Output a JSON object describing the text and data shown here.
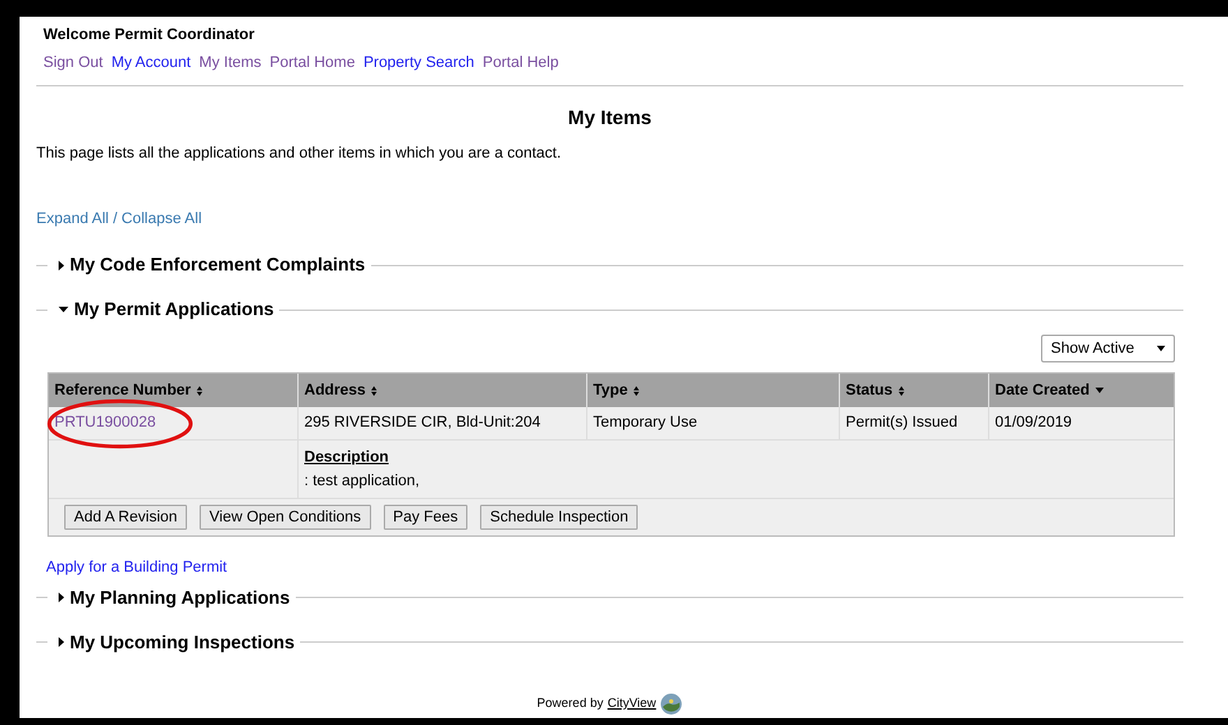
{
  "header": {
    "welcome": "Welcome Permit Coordinator",
    "nav": [
      {
        "label": "Sign Out",
        "visited": true
      },
      {
        "label": "My Account",
        "visited": false
      },
      {
        "label": "My Items",
        "visited": true
      },
      {
        "label": "Portal Home",
        "visited": true
      },
      {
        "label": "Property Search",
        "visited": false
      },
      {
        "label": "Portal Help",
        "visited": true
      }
    ]
  },
  "page_title": "My Items",
  "intro": "This page lists all the applications and other items in which you are a contact.",
  "expand_collapse": {
    "expand": "Expand All",
    "separator": "/",
    "collapse": "Collapse All"
  },
  "sections": [
    {
      "title": "My Code Enforcement Complaints",
      "expanded": false
    },
    {
      "title": "My Permit Applications",
      "expanded": true,
      "filter": {
        "value": "Show Active"
      },
      "table": {
        "columns": [
          {
            "label": "Reference Number",
            "sorted": false
          },
          {
            "label": "Address",
            "sorted": false
          },
          {
            "label": "Type",
            "sorted": false
          },
          {
            "label": "Status",
            "sorted": false
          },
          {
            "label": "Date Created",
            "sorted": true
          }
        ],
        "rows": [
          {
            "reference": "PRTU1900028",
            "address": "295 RIVERSIDE CIR, Bld-Unit:204",
            "type": "Temporary Use",
            "status": "Permit(s) Issued",
            "date_created": "01/09/2019",
            "description_label": "Description",
            "description": ": test application,",
            "highlighted": true
          }
        ],
        "actions": [
          "Add A Revision",
          "View Open Conditions",
          "Pay Fees",
          "Schedule Inspection"
        ]
      },
      "link": "Apply for a Building Permit"
    },
    {
      "title": "My Planning Applications",
      "expanded": false
    },
    {
      "title": "My Upcoming Inspections",
      "expanded": false
    }
  ],
  "footer": {
    "powered_by": "Powered by",
    "brand": "CityView"
  }
}
